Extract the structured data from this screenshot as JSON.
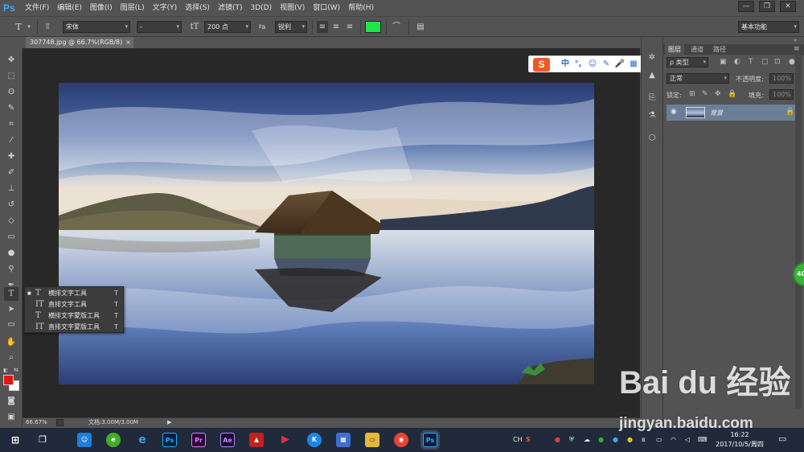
{
  "app": {
    "logo": "Ps"
  },
  "menu": [
    "文件(F)",
    "编辑(E)",
    "图像(I)",
    "图层(L)",
    "文字(Y)",
    "选择(S)",
    "滤镜(T)",
    "3D(D)",
    "视图(V)",
    "窗口(W)",
    "帮助(H)"
  ],
  "window_controls": {
    "minimize": "—",
    "restore": "❐",
    "close": "✕"
  },
  "options_bar": {
    "font_family": "宋体",
    "font_style": "-",
    "font_size": "200 点",
    "aa_glyph": "ªa",
    "antialias": "锐利",
    "color": "#1ee64a",
    "workspace": "基本功能"
  },
  "document": {
    "tab_title": "307748.jpg @ 66.7%(RGB/8)",
    "close": "×"
  },
  "colors": {
    "foreground": "#e61414",
    "background": "#ffffff",
    "accent": "#31a8ff"
  },
  "flyout": [
    {
      "icon": "T",
      "label": "横排文字工具",
      "shortcut": "T",
      "active": true
    },
    {
      "icon": "IT",
      "label": "直排文字工具",
      "shortcut": "T",
      "active": false
    },
    {
      "icon": "T",
      "label": "横排文字蒙版工具",
      "shortcut": "T",
      "active": false
    },
    {
      "icon": "IT",
      "label": "直排文字蒙版工具",
      "shortcut": "T",
      "active": false
    }
  ],
  "ime": {
    "logo": "S",
    "lang": "中"
  },
  "panel": {
    "tabs": [
      "图层",
      "通道",
      "路径"
    ],
    "kind_filter": "ρ 类型",
    "blend_mode": "正常",
    "opacity_label": "不透明度:",
    "opacity_value": "100%",
    "lock_label": "锁定:",
    "fill_label": "填充:",
    "fill_value": "100%",
    "layer_name": "背景"
  },
  "status": {
    "zoom": "66.67%",
    "doc_info": "文档:3.00M/3.00M"
  },
  "taskbar": {
    "apps": [
      "Ps",
      "Pr",
      "Ae",
      "Ps"
    ],
    "tray_lang": "CH",
    "time": "16:22",
    "date": "2017/10/5/周四"
  },
  "badge": "40",
  "watermark": {
    "brand": "Bai du 经验",
    "url": "jingyan.baidu.com"
  }
}
